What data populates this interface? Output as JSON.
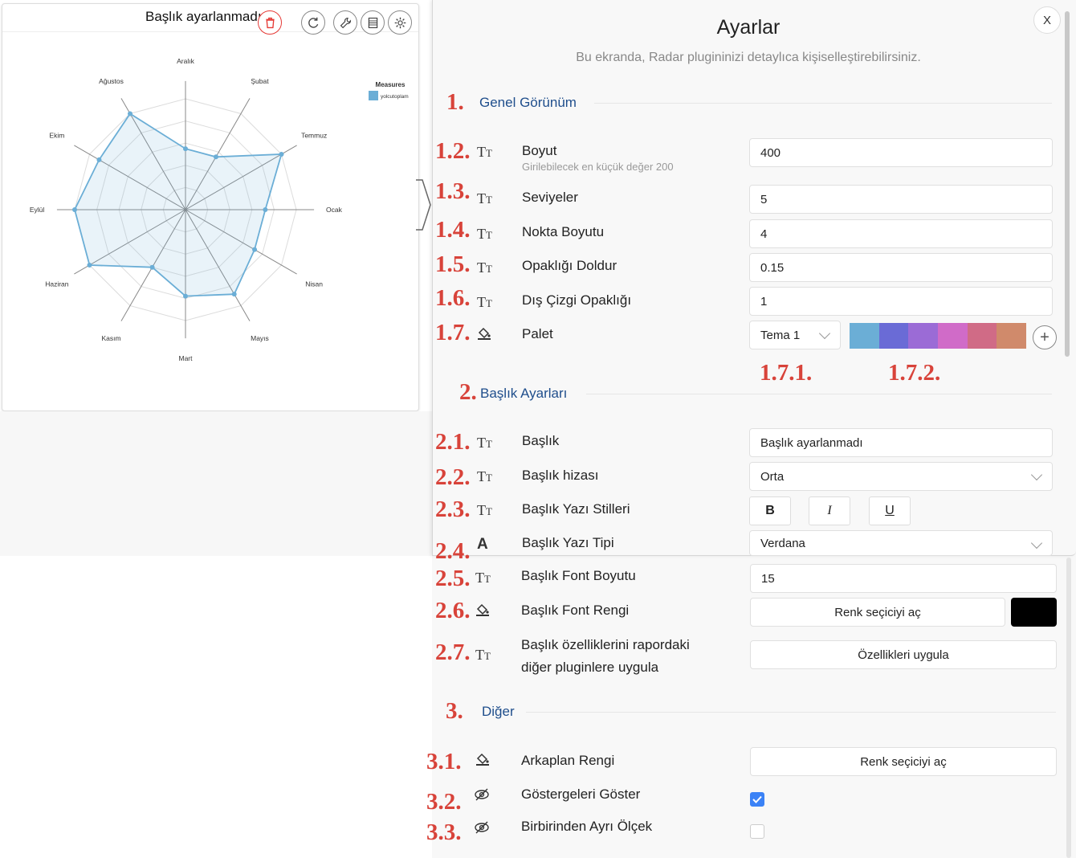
{
  "widget": {
    "title": "Başlık ayarlanmadı",
    "toolbar": {
      "delete": "trash-icon",
      "refresh": "refresh-icon",
      "wrench": "wrench-icon",
      "table": "table-icon",
      "settings": "gear-icon"
    }
  },
  "chart_data": {
    "type": "radar",
    "categories": [
      "Aralık",
      "Şubat",
      "Temmuz",
      "Ocak",
      "Nisan",
      "Mayıs",
      "Mart",
      "Kasım",
      "Haziran",
      "Eylül",
      "Ekim",
      "Ağustos"
    ],
    "series": [
      {
        "name": "yolcutoplam",
        "values": [
          0.55,
          0.55,
          1.0,
          0.72,
          0.72,
          0.88,
          0.78,
          0.6,
          1.0,
          1.0,
          0.9,
          1.0
        ]
      }
    ],
    "levels": 5,
    "legend_title": "Measures",
    "legend_position": "top-right",
    "color": "#6baed6",
    "fill_opacity": 0.15
  },
  "panel": {
    "close_label": "X",
    "title": "Ayarlar",
    "subtitle": "Bu ekranda, Radar plugininizi detaylıca kişiselleştirebilirsiniz.",
    "sections": {
      "general": {
        "num": "1.",
        "title": "Genel Görünüm"
      },
      "title": {
        "num": "2.",
        "title": "Başlık Ayarları"
      },
      "other": {
        "num": "3.",
        "title": "Diğer"
      }
    },
    "rows": {
      "size": {
        "num": "1.2.",
        "label": "Boyut",
        "hint": "Girilebilecek en küçük değer 200",
        "value": "400"
      },
      "levels": {
        "num": "1.3.",
        "label": "Seviyeler",
        "value": "5"
      },
      "dot": {
        "num": "1.4.",
        "label": "Nokta Boyutu",
        "value": "4"
      },
      "fill": {
        "num": "1.5.",
        "label": "Opaklığı Doldur",
        "value": "0.15"
      },
      "stroke": {
        "num": "1.6.",
        "label": "Dış Çizgi Opaklığı",
        "value": "1"
      },
      "palette": {
        "num": "1.7.",
        "label": "Palet",
        "value": "Tema 1",
        "sub1": "1.7.1.",
        "sub2": "1.7.2.",
        "colors": [
          "#6baed6",
          "#6a6bd6",
          "#9b6bd6",
          "#d06bc8",
          "#d06b86",
          "#d08a6b"
        ]
      },
      "title_text": {
        "num": "2.1.",
        "label": "Başlık",
        "value": "Başlık ayarlanmadı"
      },
      "title_align": {
        "num": "2.2.",
        "label": "Başlık hizası",
        "value": "Orta"
      },
      "title_styles": {
        "num": "2.3.",
        "label": "Başlık Yazı Stilleri",
        "bold": "B",
        "italic": "I",
        "underline": "U"
      },
      "title_font": {
        "num": "2.4.",
        "label": "Başlık Yazı Tipi",
        "value": "Verdana"
      },
      "title_size": {
        "num": "2.5.",
        "label": "Başlık Font Boyutu",
        "value": "15"
      },
      "title_color": {
        "num": "2.6.",
        "label": "Başlık Font Rengi",
        "button": "Renk seçiciyi aç",
        "color": "#000000"
      },
      "title_apply": {
        "num": "2.7.",
        "label_line1": "Başlık özelliklerini rapordaki",
        "label_line2": "diğer pluginlere uygula",
        "button": "Özellikleri uygula"
      },
      "bg_color": {
        "num": "3.1.",
        "label": "Arkaplan Rengi",
        "button": "Renk seçiciyi aç"
      },
      "show_legend": {
        "num": "3.2.",
        "label": "Göstergeleri Göster",
        "checked": true
      },
      "separate_scale": {
        "num": "3.3.",
        "label": "Birbirinden Ayrı Ölçek",
        "checked": false
      }
    }
  }
}
